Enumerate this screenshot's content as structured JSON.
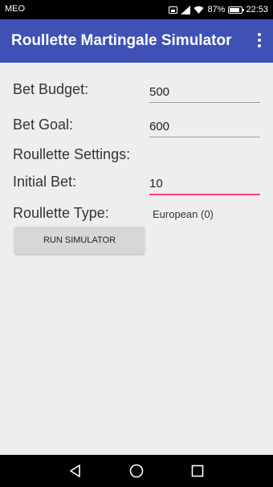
{
  "status_bar": {
    "carrier": "MEO",
    "battery": "87%",
    "time": "22:53",
    "icons": [
      "image-icon",
      "signal-icon",
      "wifi-icon",
      "battery-icon"
    ]
  },
  "app_bar": {
    "title": "Roullette Martingale Simulator",
    "menu_icon": "overflow-menu-icon",
    "color": "#3f51b5"
  },
  "form": {
    "bet_budget": {
      "label": "Bet Budget:",
      "value": "500"
    },
    "bet_goal": {
      "label": "Bet Goal:",
      "value": "600"
    },
    "settings_heading": "Roullette Settings:",
    "initial_bet": {
      "label": "Initial Bet:",
      "value": "10"
    },
    "roullette_type": {
      "label": "Roullette Type:",
      "value": "European (0)"
    },
    "run_button": "RUN SIMULATOR"
  },
  "nav_bar": {
    "icons": [
      "back-icon",
      "home-icon",
      "recents-icon"
    ]
  },
  "colors": {
    "accent": "#ff4081",
    "background": "#eeeeee"
  }
}
